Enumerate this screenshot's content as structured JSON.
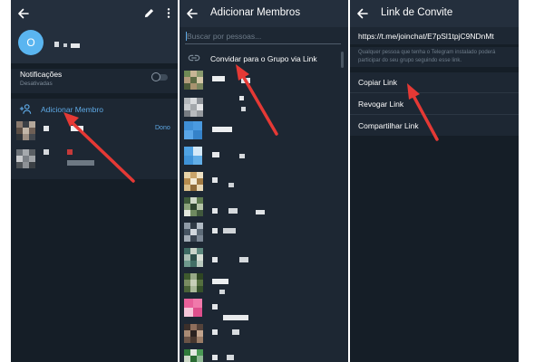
{
  "colors": {
    "panel_bg": "#1d2733",
    "header_bg": "#242f3d",
    "accent_blue": "#5ea9e5",
    "avatar_blue": "#5ab5f0",
    "annotation_red": "#e53935"
  },
  "group_info": {
    "avatar_letter": "O",
    "notifications": {
      "label": "Notificações",
      "status": "Desativadas"
    },
    "add_member_label": "Adicionar Membro",
    "owner_badge": "Dono",
    "icons": [
      "back-arrow-icon",
      "pencil-icon",
      "more-vertical-icon",
      "add-user-icon"
    ]
  },
  "add_members": {
    "title": "Adicionar Membros",
    "search_placeholder": "Buscar por pessoas...",
    "invite_label": "Convidar para o Grupo via Link",
    "icons": [
      "back-arrow-icon",
      "link-icon"
    ]
  },
  "invite_link": {
    "title": "Link de Convite",
    "url": "https://t.me/joinchat/E7pSl1tpjC9NDnMt",
    "hint": "Qualquer pessoa que tenha o Telegram instalado poderá participar do seu grupo seguindo esse link.",
    "actions": [
      "Copiar Link",
      "Revogar Link",
      "Compartilhar Link"
    ],
    "icons": [
      "back-arrow-icon"
    ]
  }
}
